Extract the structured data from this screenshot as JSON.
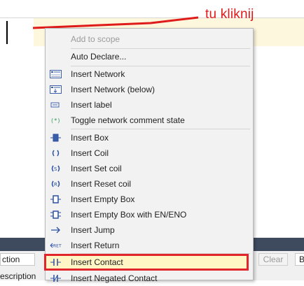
{
  "annotation": {
    "text": "tu kliknij",
    "color": "#e01b1b"
  },
  "menu": {
    "items": [
      {
        "label": "Add to scope",
        "icon": "none",
        "disabled": true
      },
      {
        "label": "Auto Declare...",
        "icon": "none"
      },
      {
        "label": "Insert Network",
        "icon": "network-icon"
      },
      {
        "label": "Insert Network (below)",
        "icon": "network-below-icon"
      },
      {
        "label": "Insert label",
        "icon": "label-icon"
      },
      {
        "label": "Toggle network comment state",
        "icon": "comment-toggle-icon"
      },
      {
        "label": "Insert Box",
        "icon": "box-icon"
      },
      {
        "label": "Insert Coil",
        "icon": "coil-icon"
      },
      {
        "label": "Insert Set coil",
        "icon": "set-coil-icon"
      },
      {
        "label": "Insert Reset coil",
        "icon": "reset-coil-icon"
      },
      {
        "label": "Insert Empty Box",
        "icon": "empty-box-icon"
      },
      {
        "label": "Insert Empty Box with EN/ENO",
        "icon": "empty-box-en-icon"
      },
      {
        "label": "Insert Jump",
        "icon": "jump-icon"
      },
      {
        "label": "Insert Return",
        "icon": "return-icon"
      },
      {
        "label": "Insert Contact",
        "icon": "contact-icon",
        "highlighted": true
      },
      {
        "label": "Insert Negated Contact",
        "icon": "negated-contact-icon"
      }
    ],
    "highlight_color": "#e0262a"
  },
  "bottom_panel": {
    "field_text": "ction",
    "desc_text": "escription",
    "clear_label": "Clear",
    "b_label": "B"
  }
}
